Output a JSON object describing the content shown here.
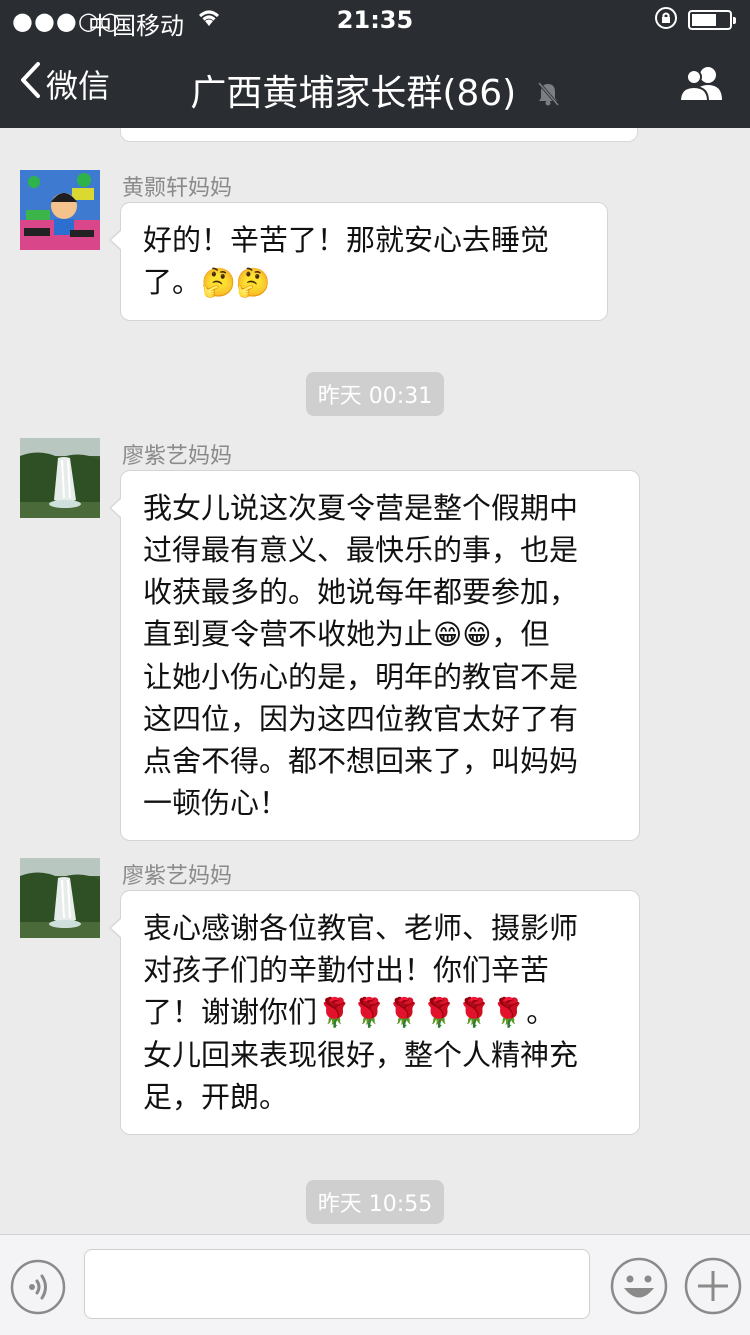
{
  "status_bar": {
    "signal": "●●●○○",
    "carrier": "中国移动",
    "time": "21:35"
  },
  "nav": {
    "back_label": "微信",
    "title": "广西黄埔家长群(86)"
  },
  "messages": [
    {
      "sender": "黄颢轩妈妈",
      "lines": [
        "好的！辛苦了！那就安心去睡觉",
        "了。"
      ],
      "emoji_tail": [
        "🤔",
        "🤔"
      ]
    },
    {
      "sender": "廖紫艺妈妈",
      "lines": [
        "我女儿说这次夏令营是整个假期中",
        "过得最有意义、最快乐的事，也是",
        "收获最多的。她说每年都要参加，",
        "直到夏令营不收她为止",
        "，但",
        "让她小伤心的是，明年的教官不是",
        "这四位，因为这四位教官太好了有",
        "点舍不得。都不想回来了，叫妈妈",
        "一顿伤心！"
      ],
      "emoji": [
        "😁",
        "😁"
      ]
    },
    {
      "sender": "廖紫艺妈妈",
      "lines": [
        "衷心感谢各位教官、老师、摄影师",
        "对孩子们的辛勤付出！你们辛苦",
        "了！谢谢你们",
        "。",
        "女儿回来表现很好，整个人精神充",
        "足，开朗。"
      ],
      "roses": [
        "🌹",
        "🌹",
        "🌹",
        "🌹",
        "🌹",
        "🌹"
      ]
    }
  ],
  "timestamps": [
    "昨天 00:31",
    "昨天 10:55"
  ],
  "input": {
    "value": ""
  }
}
